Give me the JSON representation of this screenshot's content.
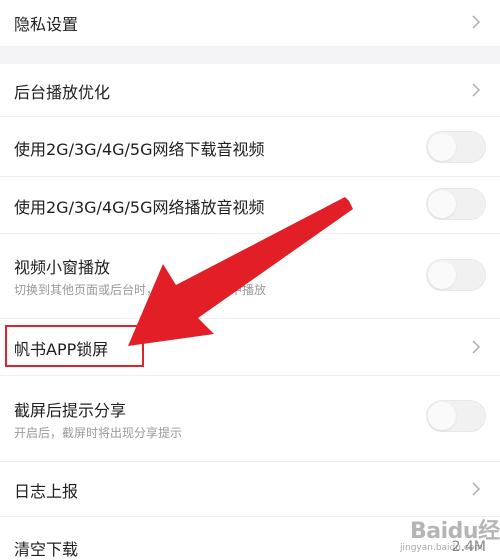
{
  "settings": {
    "privacy": {
      "label": "隐私设置"
    },
    "background_play": {
      "label": "后台播放优化"
    },
    "mobile_download": {
      "label": "使用2G/3G/4G/5G网络下载音视频",
      "enabled": false
    },
    "mobile_play": {
      "label": "使用2G/3G/4G/5G网络播放音视频",
      "enabled": false
    },
    "mini_window": {
      "label": "视频小窗播放",
      "description": "切换到其他页面或后台时，视频保持小窗中播放",
      "enabled": false
    },
    "app_lock": {
      "label": "帆书APP锁屏"
    },
    "screenshot_share": {
      "label": "截屏后提示分享",
      "description": "开启后，截屏时将出现分享提示",
      "enabled": false
    },
    "log_report": {
      "label": "日志上报"
    },
    "clear_downloads": {
      "label": "清空下载",
      "value": "2.4M"
    }
  },
  "watermark": {
    "text": "Baidu经验",
    "url": "jingyan.baidu.com"
  },
  "colors": {
    "highlight": "#e0242a",
    "arrow": "#e21f26",
    "toggle_off": "#f1f1f1"
  }
}
